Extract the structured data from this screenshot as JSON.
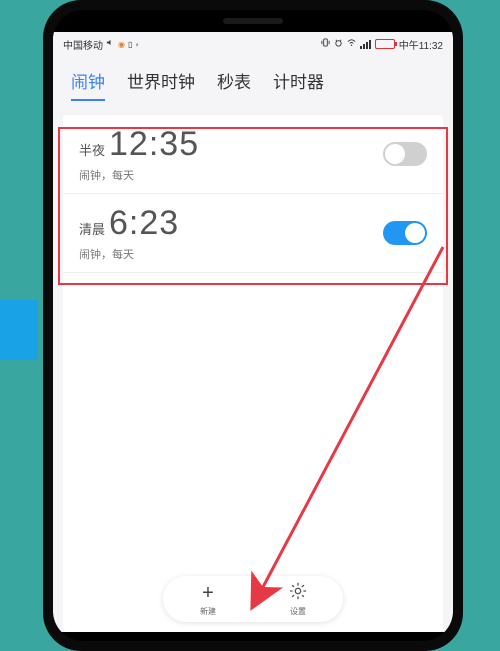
{
  "status": {
    "carrier": "中国移动",
    "time_label": "中午11:32"
  },
  "tabs": {
    "alarm": "闹钟",
    "world_clock": "世界时钟",
    "stopwatch": "秒表",
    "timer": "计时器"
  },
  "alarms": [
    {
      "period": "半夜",
      "time": "12:35",
      "sub": "闹钟，每天",
      "enabled": false
    },
    {
      "period": "清晨",
      "time": "6:23",
      "sub": "闹钟，每天",
      "enabled": true
    }
  ],
  "bottom": {
    "new": "新建",
    "settings": "设置"
  }
}
